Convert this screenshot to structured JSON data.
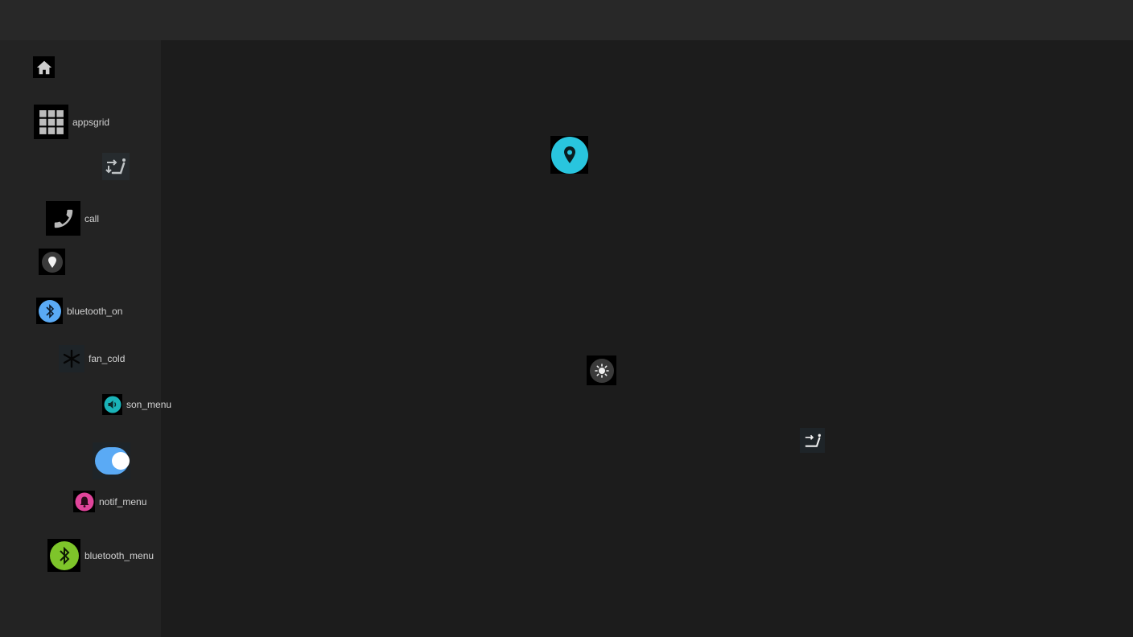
{
  "sidebar": {
    "items": [
      {
        "icon": "home-icon",
        "label": ""
      },
      {
        "icon": "apps-grid-icon",
        "label": "appsgrid"
      },
      {
        "icon": "seat-recline-icon",
        "label": ""
      },
      {
        "icon": "phone-icon",
        "label": "call"
      },
      {
        "icon": "location-pin-icon",
        "label": ""
      },
      {
        "icon": "bluetooth-icon",
        "label": "bluetooth_on"
      },
      {
        "icon": "snowflake-icon",
        "label": "fan_cold"
      },
      {
        "icon": "volume-icon",
        "label": "son_menu"
      },
      {
        "icon": "toggle-switch-icon",
        "label": ""
      },
      {
        "icon": "bell-icon",
        "label": "notif_menu"
      },
      {
        "icon": "bluetooth-icon",
        "label": "bluetooth_menu"
      }
    ]
  },
  "main": {
    "icons": [
      {
        "icon": "location-pin-icon",
        "color": "#29c5de"
      },
      {
        "icon": "brightness-icon",
        "color": "#3a3a3a"
      },
      {
        "icon": "seat-recline-icon",
        "color": "#1e2428"
      }
    ]
  },
  "colors": {
    "bluetooth_on": "#5aaaf5",
    "son_menu": "#1ab3b8",
    "toggle": "#5aaaf5",
    "notif_menu": "#e0449a",
    "bluetooth_menu": "#7ec52a",
    "location": "#29c5de"
  }
}
